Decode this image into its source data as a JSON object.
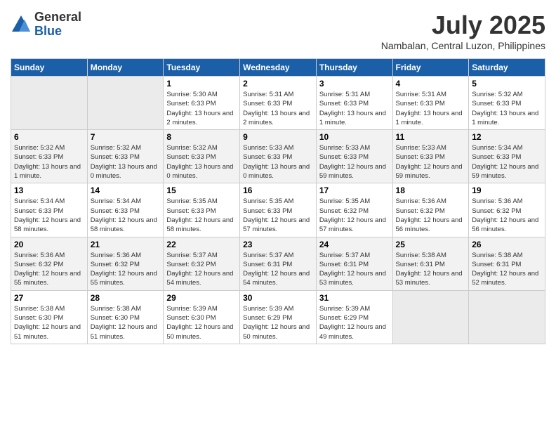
{
  "logo": {
    "general": "General",
    "blue": "Blue"
  },
  "title": "July 2025",
  "subtitle": "Nambalan, Central Luzon, Philippines",
  "days_of_week": [
    "Sunday",
    "Monday",
    "Tuesday",
    "Wednesday",
    "Thursday",
    "Friday",
    "Saturday"
  ],
  "weeks": [
    [
      {
        "day": "",
        "info": ""
      },
      {
        "day": "",
        "info": ""
      },
      {
        "day": "1",
        "info": "Sunrise: 5:30 AM\nSunset: 6:33 PM\nDaylight: 13 hours and 2 minutes."
      },
      {
        "day": "2",
        "info": "Sunrise: 5:31 AM\nSunset: 6:33 PM\nDaylight: 13 hours and 2 minutes."
      },
      {
        "day": "3",
        "info": "Sunrise: 5:31 AM\nSunset: 6:33 PM\nDaylight: 13 hours and 1 minute."
      },
      {
        "day": "4",
        "info": "Sunrise: 5:31 AM\nSunset: 6:33 PM\nDaylight: 13 hours and 1 minute."
      },
      {
        "day": "5",
        "info": "Sunrise: 5:32 AM\nSunset: 6:33 PM\nDaylight: 13 hours and 1 minute."
      }
    ],
    [
      {
        "day": "6",
        "info": "Sunrise: 5:32 AM\nSunset: 6:33 PM\nDaylight: 13 hours and 1 minute."
      },
      {
        "day": "7",
        "info": "Sunrise: 5:32 AM\nSunset: 6:33 PM\nDaylight: 13 hours and 0 minutes."
      },
      {
        "day": "8",
        "info": "Sunrise: 5:32 AM\nSunset: 6:33 PM\nDaylight: 13 hours and 0 minutes."
      },
      {
        "day": "9",
        "info": "Sunrise: 5:33 AM\nSunset: 6:33 PM\nDaylight: 13 hours and 0 minutes."
      },
      {
        "day": "10",
        "info": "Sunrise: 5:33 AM\nSunset: 6:33 PM\nDaylight: 12 hours and 59 minutes."
      },
      {
        "day": "11",
        "info": "Sunrise: 5:33 AM\nSunset: 6:33 PM\nDaylight: 12 hours and 59 minutes."
      },
      {
        "day": "12",
        "info": "Sunrise: 5:34 AM\nSunset: 6:33 PM\nDaylight: 12 hours and 59 minutes."
      }
    ],
    [
      {
        "day": "13",
        "info": "Sunrise: 5:34 AM\nSunset: 6:33 PM\nDaylight: 12 hours and 58 minutes."
      },
      {
        "day": "14",
        "info": "Sunrise: 5:34 AM\nSunset: 6:33 PM\nDaylight: 12 hours and 58 minutes."
      },
      {
        "day": "15",
        "info": "Sunrise: 5:35 AM\nSunset: 6:33 PM\nDaylight: 12 hours and 58 minutes."
      },
      {
        "day": "16",
        "info": "Sunrise: 5:35 AM\nSunset: 6:33 PM\nDaylight: 12 hours and 57 minutes."
      },
      {
        "day": "17",
        "info": "Sunrise: 5:35 AM\nSunset: 6:32 PM\nDaylight: 12 hours and 57 minutes."
      },
      {
        "day": "18",
        "info": "Sunrise: 5:36 AM\nSunset: 6:32 PM\nDaylight: 12 hours and 56 minutes."
      },
      {
        "day": "19",
        "info": "Sunrise: 5:36 AM\nSunset: 6:32 PM\nDaylight: 12 hours and 56 minutes."
      }
    ],
    [
      {
        "day": "20",
        "info": "Sunrise: 5:36 AM\nSunset: 6:32 PM\nDaylight: 12 hours and 55 minutes."
      },
      {
        "day": "21",
        "info": "Sunrise: 5:36 AM\nSunset: 6:32 PM\nDaylight: 12 hours and 55 minutes."
      },
      {
        "day": "22",
        "info": "Sunrise: 5:37 AM\nSunset: 6:32 PM\nDaylight: 12 hours and 54 minutes."
      },
      {
        "day": "23",
        "info": "Sunrise: 5:37 AM\nSunset: 6:31 PM\nDaylight: 12 hours and 54 minutes."
      },
      {
        "day": "24",
        "info": "Sunrise: 5:37 AM\nSunset: 6:31 PM\nDaylight: 12 hours and 53 minutes."
      },
      {
        "day": "25",
        "info": "Sunrise: 5:38 AM\nSunset: 6:31 PM\nDaylight: 12 hours and 53 minutes."
      },
      {
        "day": "26",
        "info": "Sunrise: 5:38 AM\nSunset: 6:31 PM\nDaylight: 12 hours and 52 minutes."
      }
    ],
    [
      {
        "day": "27",
        "info": "Sunrise: 5:38 AM\nSunset: 6:30 PM\nDaylight: 12 hours and 51 minutes."
      },
      {
        "day": "28",
        "info": "Sunrise: 5:38 AM\nSunset: 6:30 PM\nDaylight: 12 hours and 51 minutes."
      },
      {
        "day": "29",
        "info": "Sunrise: 5:39 AM\nSunset: 6:30 PM\nDaylight: 12 hours and 50 minutes."
      },
      {
        "day": "30",
        "info": "Sunrise: 5:39 AM\nSunset: 6:29 PM\nDaylight: 12 hours and 50 minutes."
      },
      {
        "day": "31",
        "info": "Sunrise: 5:39 AM\nSunset: 6:29 PM\nDaylight: 12 hours and 49 minutes."
      },
      {
        "day": "",
        "info": ""
      },
      {
        "day": "",
        "info": ""
      }
    ]
  ]
}
